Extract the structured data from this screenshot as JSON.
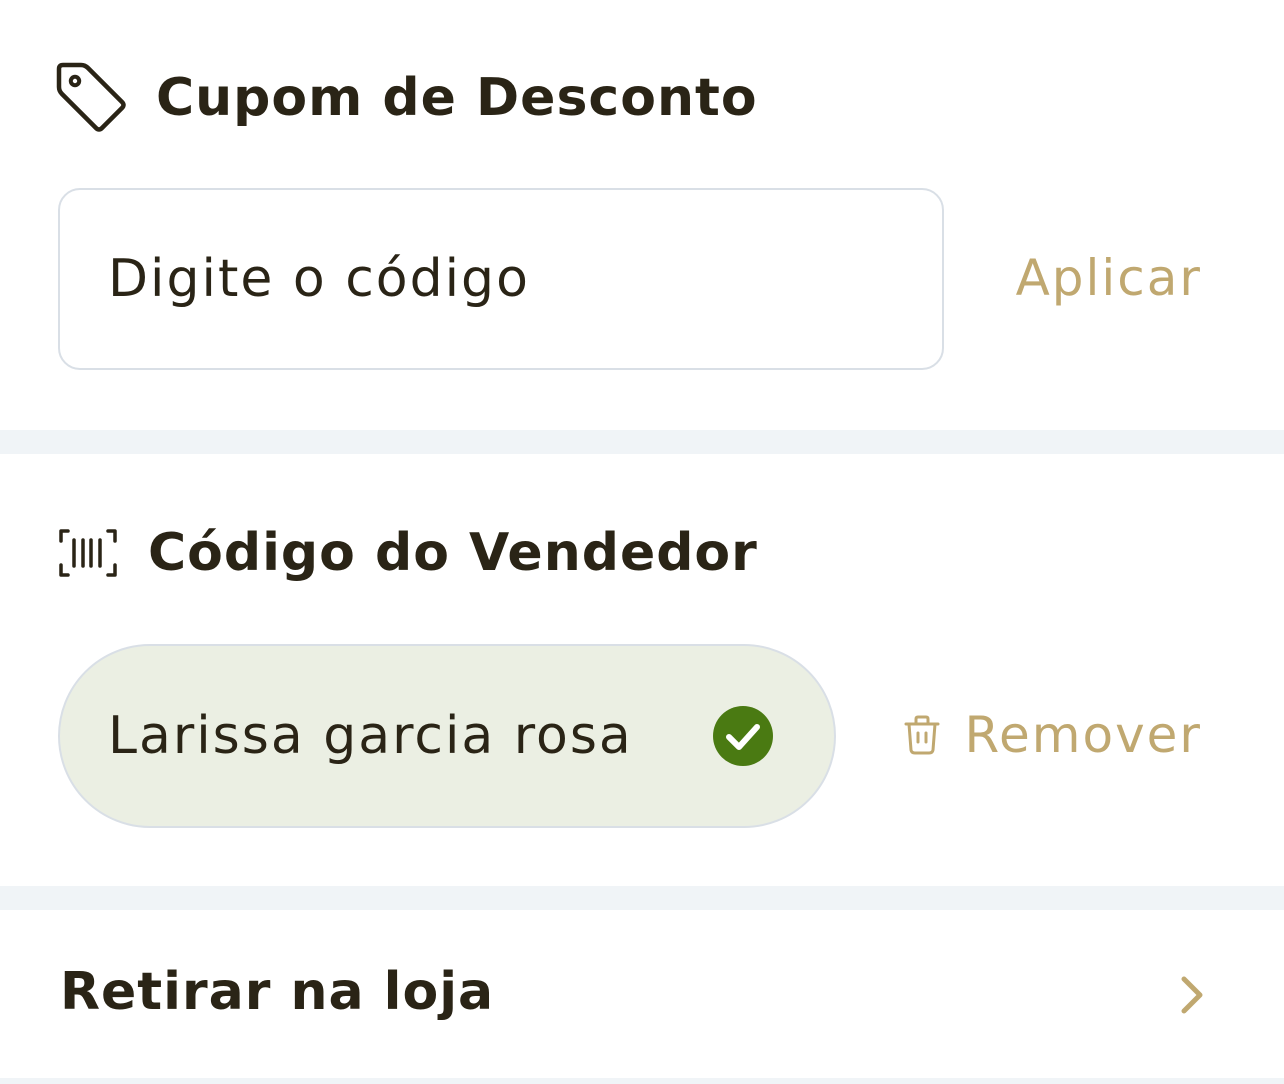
{
  "coupon": {
    "title": "Cupom de Desconto",
    "input_placeholder": "Digite o código",
    "input_value": "",
    "apply_label": "Aplicar",
    "icon": "tag-icon"
  },
  "seller": {
    "title": "Código do Vendedor",
    "value": "Larissa garcia rosa",
    "status": "verified",
    "remove_label": "Remover",
    "icon": "barcode-scan-icon"
  },
  "pickup": {
    "label": "Retirar na loja",
    "icon": "chevron-right-icon"
  },
  "colors": {
    "text": "#2a2416",
    "accent": "#c0a870",
    "success": "#4a7a12",
    "pill_bg": "#ebefe3",
    "border": "#d9dfe6",
    "page_bg": "#f0f4f7"
  }
}
